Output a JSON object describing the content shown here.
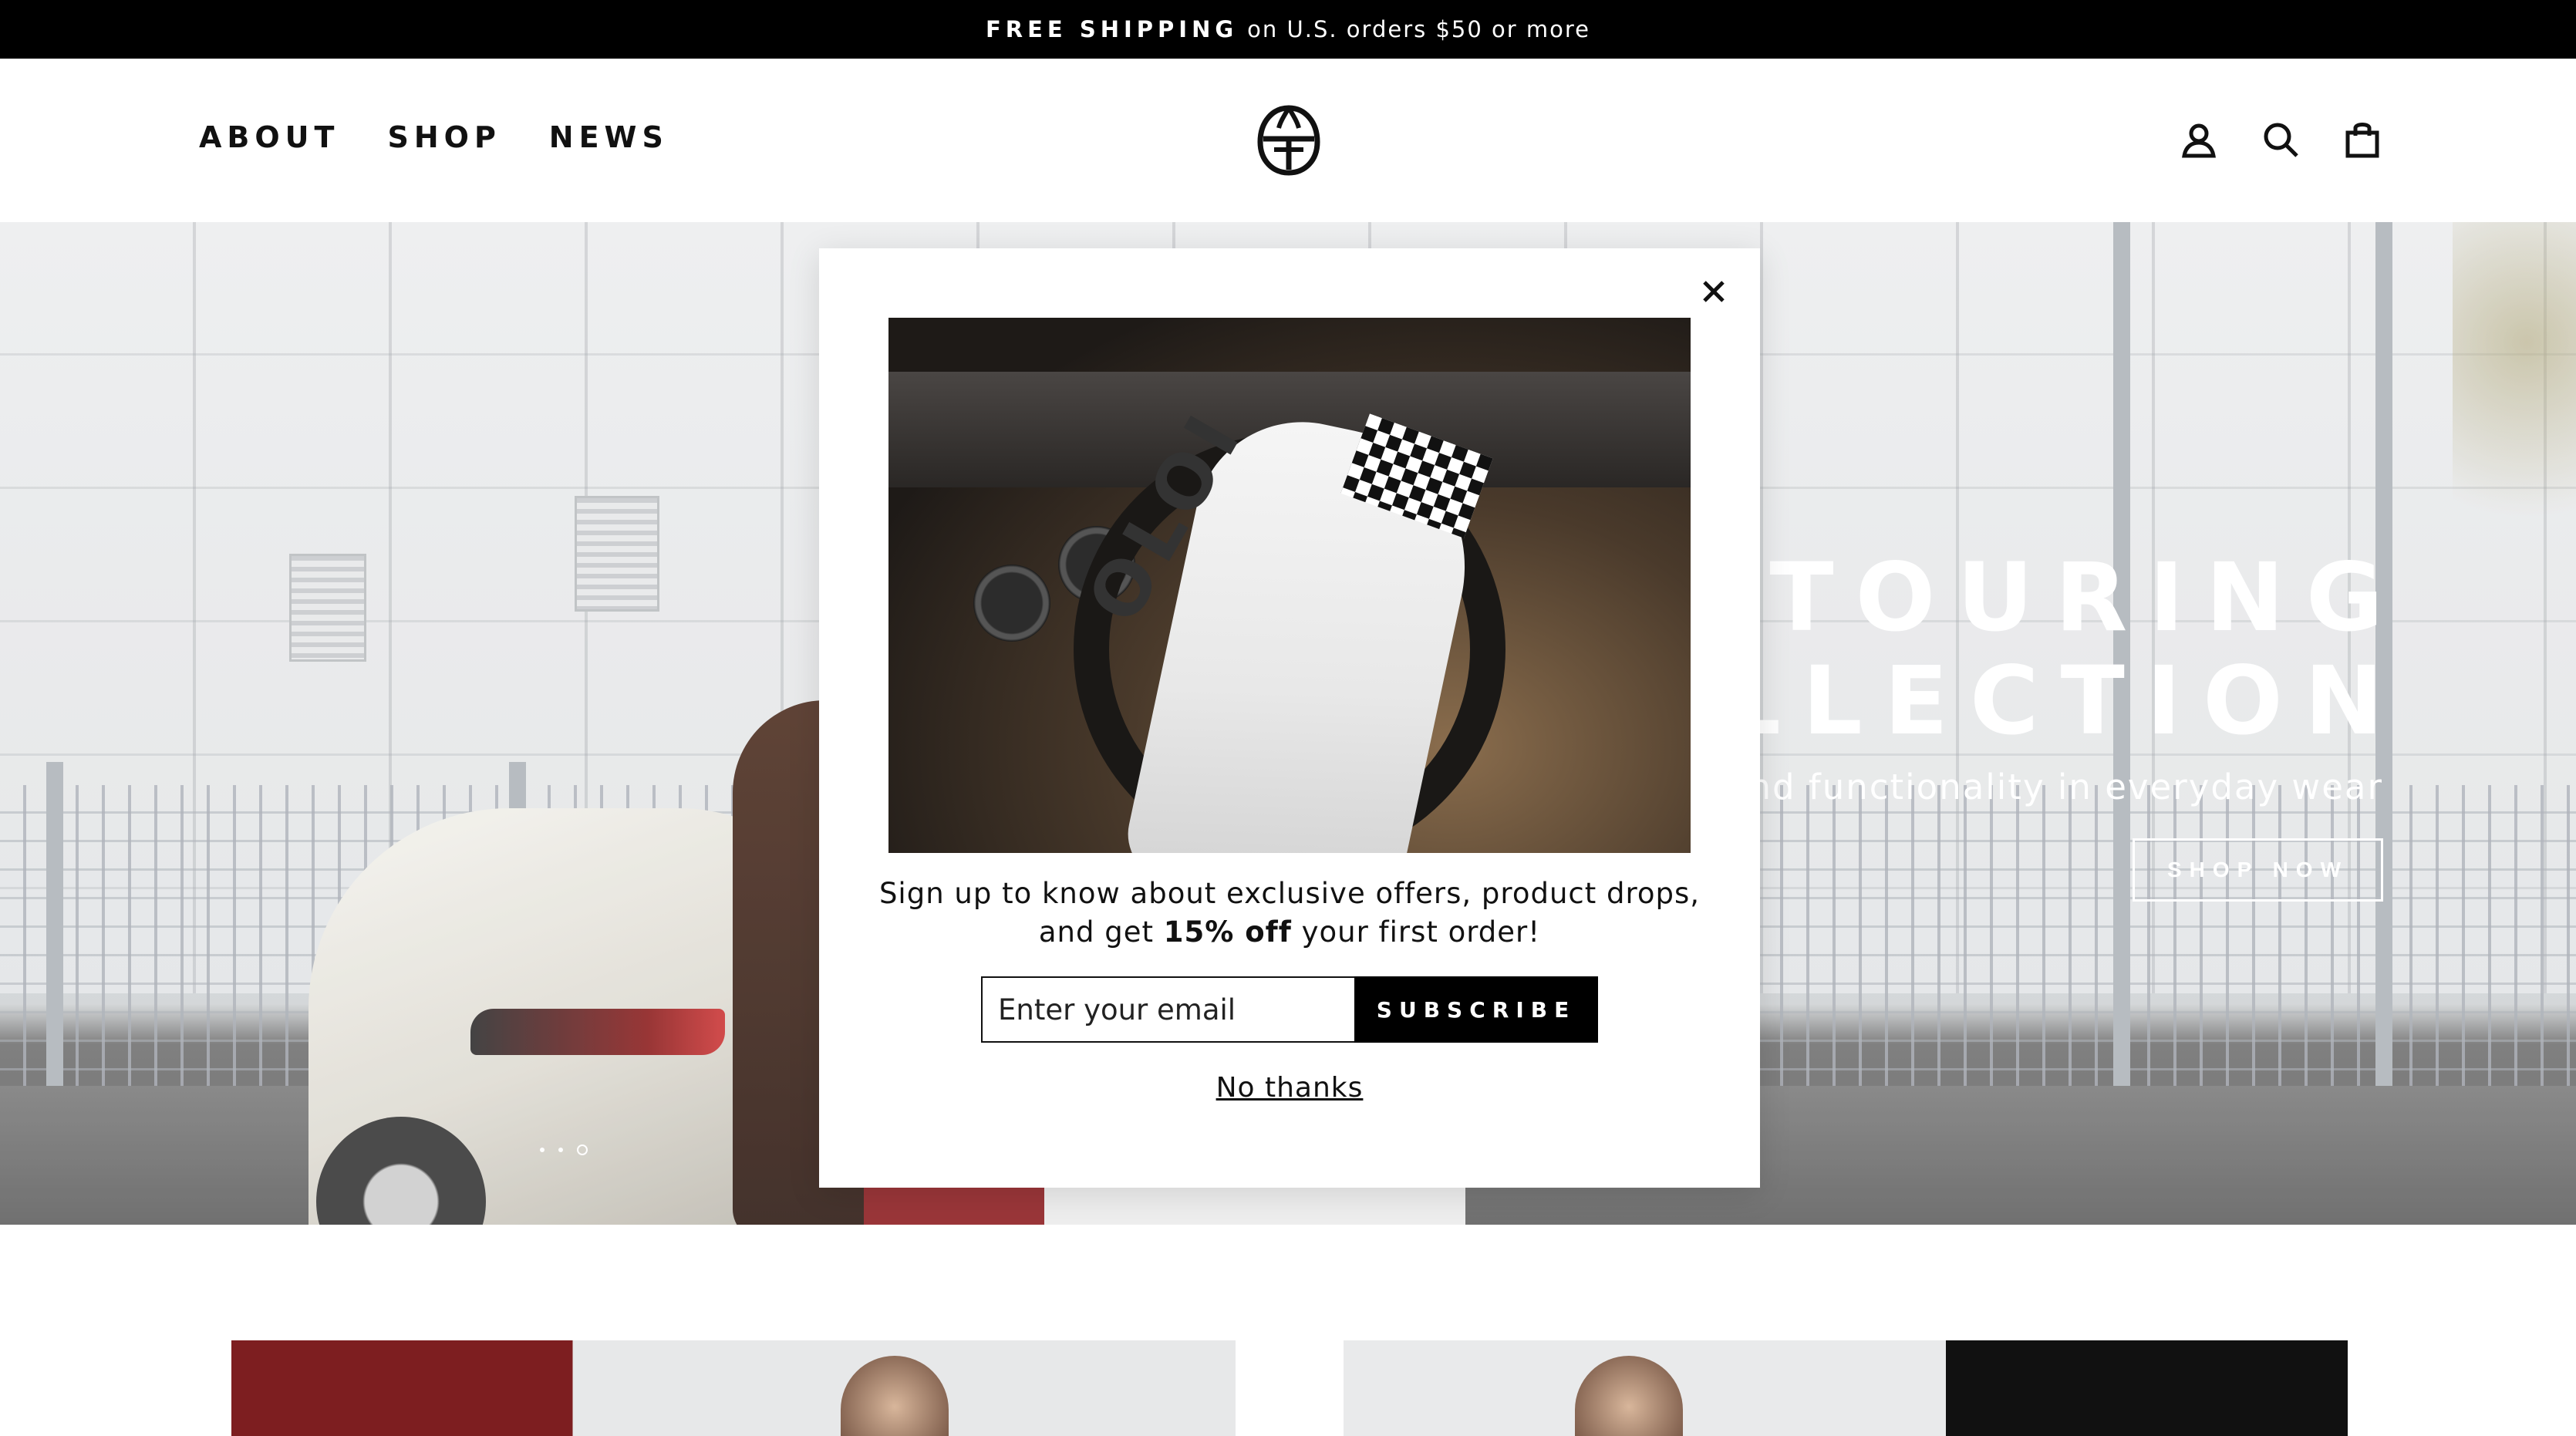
{
  "announcement": {
    "bold": "FREE SHIPPING",
    "text": "on U.S. orders $50 or more"
  },
  "nav": [
    {
      "label": "ABOUT"
    },
    {
      "label": "SHOP"
    },
    {
      "label": "NEWS"
    }
  ],
  "header_icons": [
    "account-icon",
    "search-icon",
    "cart-icon"
  ],
  "hero": {
    "title_line1": "TOURING",
    "title_line2": "OLLECTION",
    "subtitle": "e and functionality in everyday wear",
    "button": "SHOP NOW"
  },
  "popup": {
    "text_line1": "Sign up to know about exclusive offers, product drops,",
    "text_pre": "and get ",
    "text_bold": "15% off",
    "text_post": " your first order!",
    "email_placeholder": "Enter your email",
    "subscribe_label": "SUBSCRIBE",
    "no_thanks_label": "No thanks",
    "image_scarf_text": "OLOI"
  },
  "colors": {
    "accent": "#000000",
    "background": "#ffffff"
  }
}
